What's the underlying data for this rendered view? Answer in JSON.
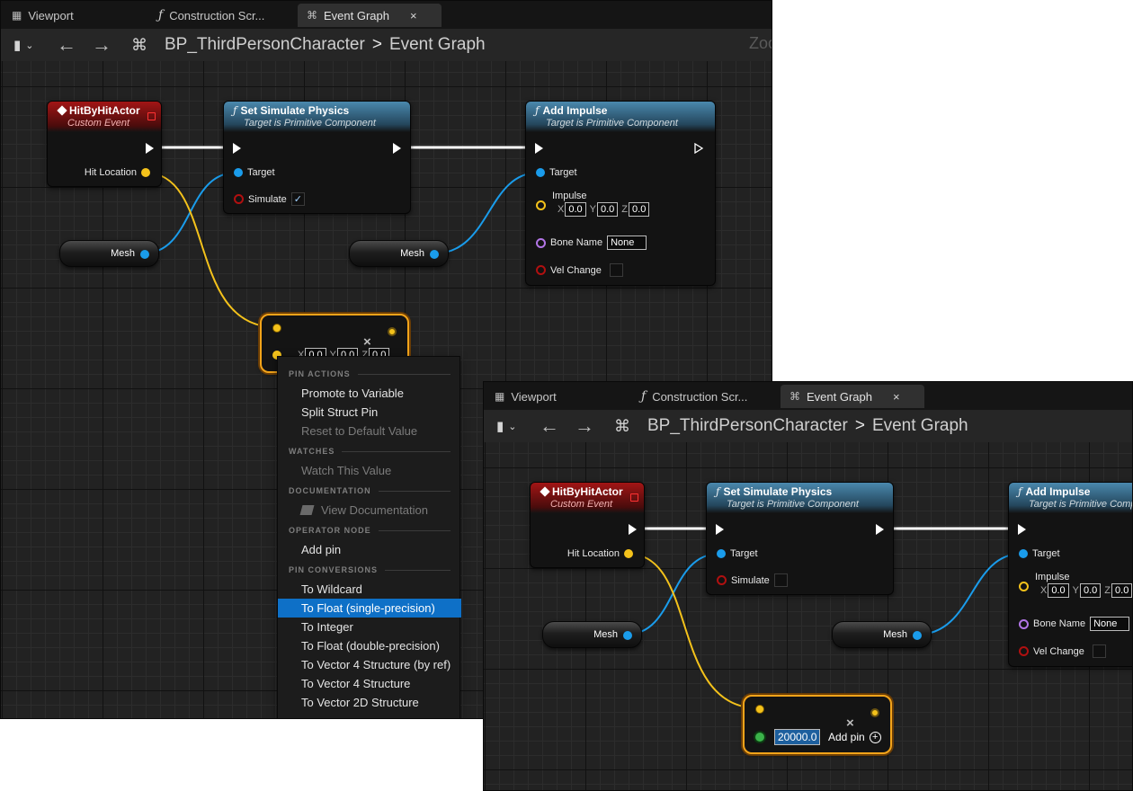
{
  "tabs": {
    "viewport": "Viewport",
    "construction": "Construction Scr...",
    "event_graph": "Event Graph",
    "close": "×"
  },
  "breadcrumb": {
    "blueprint": "BP_ThirdPersonCharacter",
    "separator": ">",
    "graph": "Event Graph"
  },
  "zoom_label": "Zoo",
  "nodes": {
    "event": {
      "title": "HitByHitActor",
      "subtitle": "Custom Event",
      "pin_hit_location": "Hit Location"
    },
    "set_physics": {
      "title": "Set Simulate Physics",
      "subtitle": "Target is Primitive Component",
      "pin_target": "Target",
      "pin_simulate": "Simulate"
    },
    "add_impulse": {
      "title": "Add Impulse",
      "subtitle": "Target is Primitive Component",
      "pin_target": "Target",
      "pin_impulse": "Impulse",
      "pin_bone_name": "Bone Name",
      "bone_name_value": "None",
      "pin_vel_change": "Vel Change",
      "x_label": "X",
      "y_label": "Y",
      "z_label": "Z",
      "x": "0.0",
      "y": "0.0",
      "z": "0.0"
    },
    "mesh_var": "Mesh"
  },
  "operator": {
    "x_label": "X",
    "y_label": "Y",
    "z_label": "Z",
    "x": "0.0",
    "y": "0.0",
    "z": "0.0",
    "float_value": "20000.0",
    "add_pin": "Add pin",
    "close_glyph": "×"
  },
  "context_menu": {
    "sections": {
      "pin_actions": "PIN ACTIONS",
      "watches": "WATCHES",
      "documentation": "DOCUMENTATION",
      "operator_node": "OPERATOR NODE",
      "pin_conversions": "PIN CONVERSIONS"
    },
    "items": {
      "promote": "Promote to Variable",
      "split": "Split Struct Pin",
      "reset": "Reset to Default Value",
      "watch": "Watch This Value",
      "view_doc": "View Documentation",
      "add_pin": "Add pin",
      "to_wildcard": "To Wildcard",
      "to_float_single": "To Float (single-precision)",
      "to_integer": "To Integer",
      "to_float_double": "To Float (double-precision)",
      "to_vector4_ref": "To Vector 4 Structure (by ref)",
      "to_vector4": "To Vector 4 Structure",
      "to_vector2d": "To Vector 2D Structure"
    }
  },
  "colors": {
    "exec_wire": "#ffffff",
    "object_pin": "#1a9ceb",
    "vector_pin": "#f4c21b",
    "float_pin": "#3bb34a",
    "selection": "#0e70c7",
    "event_header": "#a21515",
    "function_header": "#4a88ad"
  },
  "window1": {
    "simulate_checked": true
  },
  "window2": {
    "simulate_checked": false
  }
}
